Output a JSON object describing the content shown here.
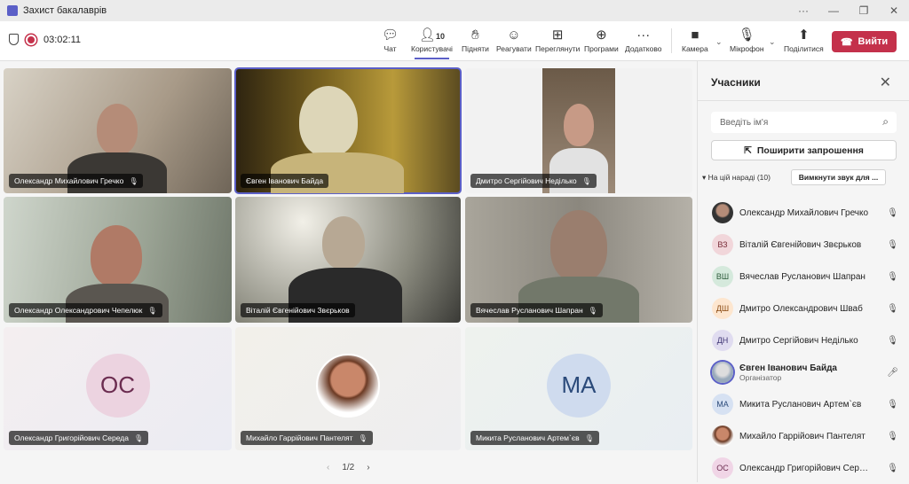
{
  "window": {
    "title": "Захист бакалаврів",
    "more": "···",
    "minimize": "—",
    "restore": "❐",
    "close": "✕"
  },
  "toolbar": {
    "timer": "03:02:11",
    "people_count": "10",
    "buttons": [
      {
        "label": "Чат",
        "icon": "chat-icon"
      },
      {
        "label": "Користувачі",
        "icon": "people-icon"
      },
      {
        "label": "Підняти",
        "icon": "hand-icon"
      },
      {
        "label": "Реагувати",
        "icon": "smile-icon"
      },
      {
        "label": "Переглянути",
        "icon": "layout-icon"
      },
      {
        "label": "Програми",
        "icon": "apps-icon"
      },
      {
        "label": "Додатково",
        "icon": "more-icon"
      },
      {
        "label": "Камера",
        "icon": "camera-icon"
      },
      {
        "label": "Мікрофон",
        "icon": "mic-off-icon"
      },
      {
        "label": "Поділитися",
        "icon": "share-icon"
      }
    ],
    "leave": "Вийти"
  },
  "tiles": [
    {
      "name": "Олександр Михайлович Гречко"
    },
    {
      "name": "Євген Іванович Байда"
    },
    {
      "name": "Дмитро Сергійович Неділько"
    },
    {
      "name": "Олександр Олександрович Чепелюк"
    },
    {
      "name": "Віталій Євгенійович Звєрьков"
    },
    {
      "name": "Вячеслав Русланович Шапран"
    },
    {
      "name": "Олександр Григорійович Середа",
      "initials": "ОС"
    },
    {
      "name": "Михайло Гаррійович Пантелят"
    },
    {
      "name": "Микита Русланович Артем`єв",
      "initials": "МА"
    }
  ],
  "pagination": {
    "prev": "‹",
    "page": "1/2",
    "next": "›"
  },
  "panel": {
    "title": "Учасники",
    "search_placeholder": "Введіть ім'я",
    "invite": "Поширити запрошення",
    "section": "На цій нараді (10)",
    "mute_all": "Вимкнути звук для ...",
    "participants": [
      {
        "name": "Олександр Михайлович Гречко",
        "initials": "",
        "mic": "off"
      },
      {
        "name": "Віталій Євгенійович Звєрьков",
        "initials": "ВЗ",
        "mic": "off"
      },
      {
        "name": "Вячеслав Русланович Шапран",
        "initials": "ВШ",
        "mic": "off"
      },
      {
        "name": "Дмитро Олександрович Шваб",
        "initials": "ДШ",
        "mic": "off"
      },
      {
        "name": "Дмитро Сергійович Неділько",
        "initials": "ДН",
        "mic": "off"
      },
      {
        "name": "Євген Іванович Байда",
        "role": "Організатор",
        "initials": "",
        "mic": "on"
      },
      {
        "name": "Микита Русланович Артем`єв",
        "initials": "МА",
        "mic": "off"
      },
      {
        "name": "Михайло Гаррійович Пантелят",
        "initials": "",
        "mic": "off"
      },
      {
        "name": "Олександр Григорійович Середа",
        "initials": "ОС",
        "mic": "off"
      }
    ]
  }
}
